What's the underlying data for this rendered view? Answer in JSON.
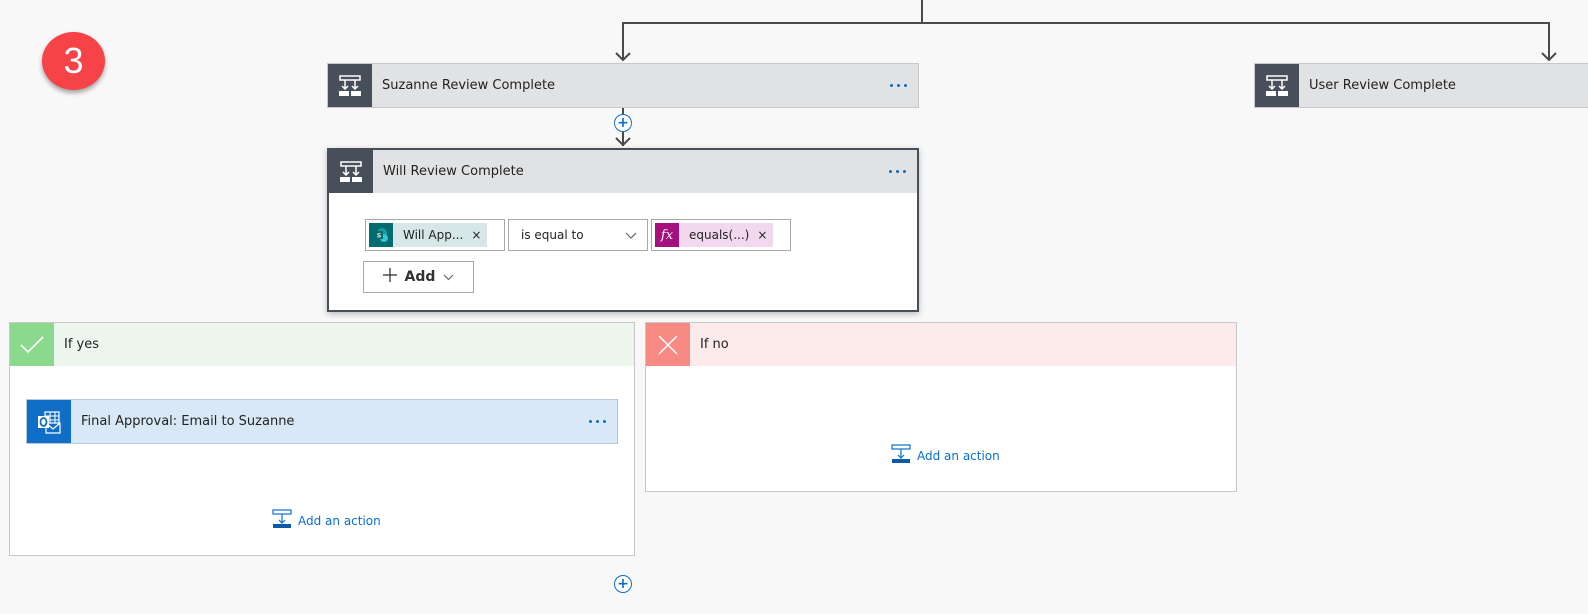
{
  "step_badge": "3",
  "cards": {
    "suzanne": {
      "title": "Suzanne Review Complete",
      "icon": "condition-icon"
    },
    "user_review": {
      "title": "User Review Complete",
      "icon": "condition-icon"
    },
    "will": {
      "title": "Will Review Complete",
      "icon": "condition-icon",
      "condition": {
        "left_token": {
          "label": "Will App...",
          "icon": "sharepoint-icon",
          "remove": "×"
        },
        "operator": "is equal to",
        "right_token": {
          "label": "equals(...)",
          "icon": "fx-icon",
          "icon_text": "fx",
          "remove": "×"
        }
      },
      "add_button": "Add"
    }
  },
  "branches": {
    "yes": {
      "title": "If yes",
      "color": "#8ad98d",
      "actions": [
        {
          "title": "Final Approval: Email to Suzanne",
          "icon": "outlook-icon"
        }
      ],
      "add_action": "Add an action"
    },
    "no": {
      "title": "If no",
      "color": "#f88a84",
      "add_action": "Add an action"
    }
  },
  "colors": {
    "accent": "#0a6ed1",
    "card_icon_bg": "#474f5a",
    "badge": "#f64347"
  }
}
